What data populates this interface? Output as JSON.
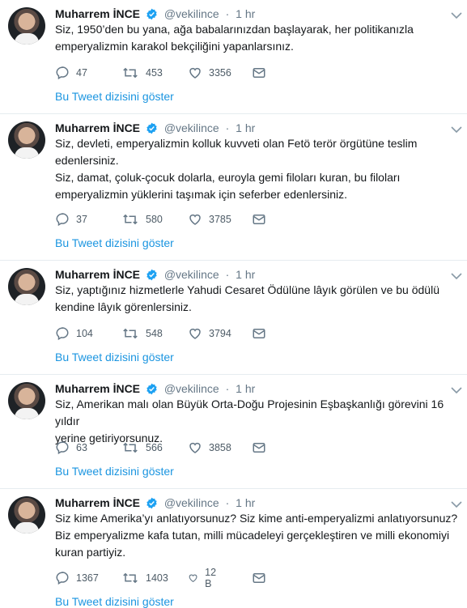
{
  "author": {
    "name": "Muharrem İNCE",
    "handle": "@vekilince",
    "time_sep": "·",
    "time": "1 hr"
  },
  "tweets": [
    {
      "lines": [
        "Siz, 1950’den bu yana, ağa babalarınızdan başlayarak, her politikanızla",
        "emperyalizmin karakol bekçiliğini yapanlarsınız."
      ],
      "replies": "47",
      "retweets": "453",
      "likes": "3356",
      "thread_link": "Bu Tweet dizisini göster"
    },
    {
      "lines": [
        "Siz, devleti, emperyalizmin kolluk kuvveti olan Fetö terör örgütüne teslim",
        "edenlersiniz.",
        "Siz, damat, çoluk-çocuk dolarla, euroyla gemi filoları kuran, bu filoları",
        "emperyalizmin yüklerini taşımak için seferber edenlersiniz."
      ],
      "replies": "37",
      "retweets": "580",
      "likes": "3785",
      "thread_link": "Bu Tweet dizisini göster"
    },
    {
      "lines": [
        "Siz, yaptığınız hizmetlerle Yahudi Cesaret Ödülüne lâyık görülen ve bu ödülü",
        "kendine lâyık görenlersiniz."
      ],
      "replies": "104",
      "retweets": "548",
      "likes": "3794",
      "thread_link": "Bu Tweet dizisini göster"
    },
    {
      "lines": [
        "Siz, Amerikan malı olan Büyük Orta-Doğu Projesinin Eşbaşkanlığı görevini 16 yıldır",
        "yerine getiriyorsunuz."
      ],
      "replies": "63",
      "retweets": "566",
      "likes": "3858",
      "thread_link": "Bu Tweet dizisini göster"
    },
    {
      "lines": [
        "Siz kime Amerika’yı anlatıyorsunuz? Siz kime anti-emperyalizmi anlatıyorsunuz?",
        "Biz emperyalizme kafa tutan, milli mücadeleyi gerçekleştiren ve milli ekonomiyi",
        "kuran partiyiz."
      ],
      "replies": "1367",
      "retweets": "1403",
      "likes": "12 B",
      "thread_link": "Bu Tweet dizisini göster"
    }
  ],
  "colors": {
    "verified": "#1da1f2",
    "link": "#1b95e0",
    "muted": "#657786"
  }
}
